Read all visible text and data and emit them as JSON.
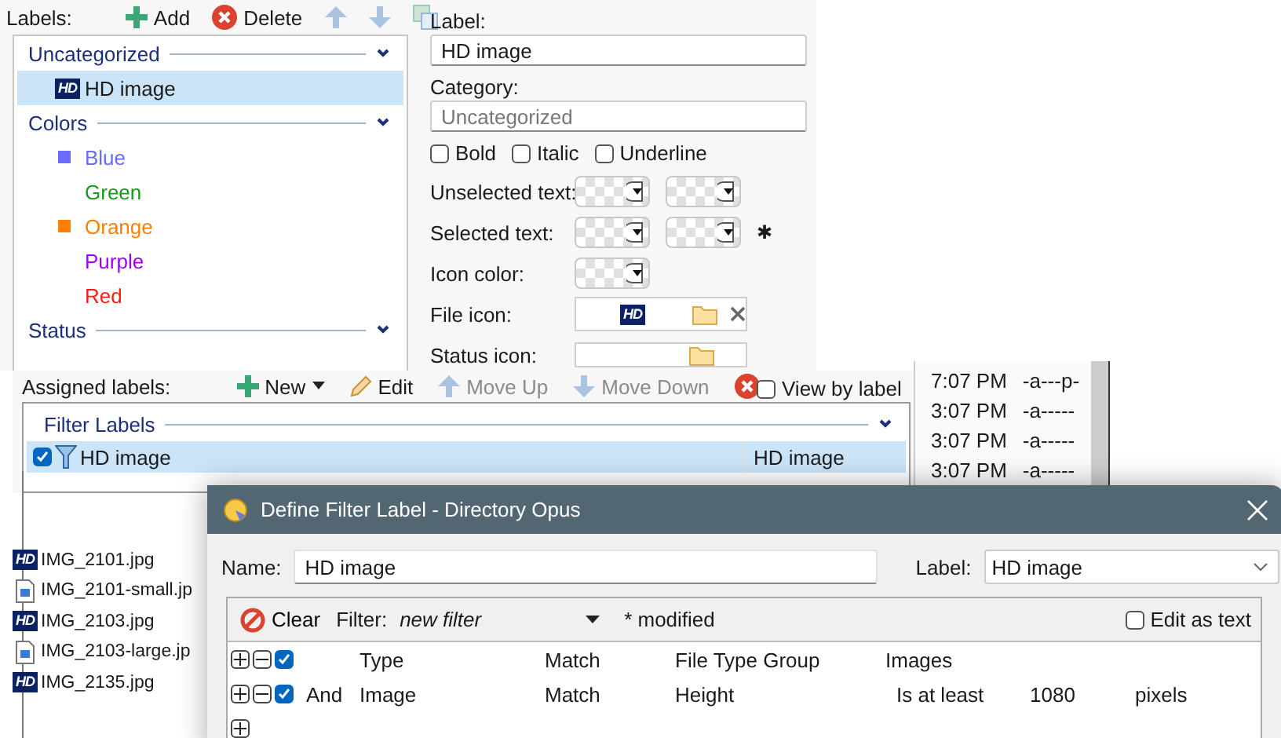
{
  "labels_panel": {
    "caption": "Labels:",
    "toolbar": [
      {
        "kind": "add",
        "label": "Add",
        "disabled": false
      },
      {
        "kind": "delete",
        "label": "Delete",
        "disabled": false
      },
      {
        "kind": "up",
        "disabled": true
      },
      {
        "kind": "down",
        "disabled": true
      },
      {
        "kind": "copy",
        "disabled": true
      }
    ],
    "groups": [
      {
        "name": "Uncategorized",
        "expanded": true,
        "items": [
          {
            "kind": "hd",
            "badge": "HD",
            "label": "HD image",
            "selected": true
          }
        ]
      },
      {
        "name": "Colors",
        "expanded": true,
        "items": [
          {
            "kind": "swatch",
            "label": "Blue",
            "color": "#6b6bff",
            "selected": false
          },
          {
            "kind": "plain",
            "label": "Green",
            "color": "#1a9a1a",
            "selected": false
          },
          {
            "kind": "swatch",
            "label": "Orange",
            "color": "#ff8000",
            "selected": false
          },
          {
            "kind": "plain",
            "label": "Purple",
            "color": "#9b00ff",
            "selected": false
          },
          {
            "kind": "plain",
            "label": "Red",
            "color": "#ff1a1a",
            "selected": false
          }
        ]
      },
      {
        "name": "Status",
        "expanded": true
      }
    ]
  },
  "label_editor": {
    "label_caption": "Label:",
    "label_value": "HD image",
    "category_caption": "Category:",
    "category_placeholder": "Uncategorized",
    "styles": [
      {
        "label": "Bold",
        "checked": false
      },
      {
        "label": "Italic",
        "checked": false
      },
      {
        "label": "Underline",
        "checked": false
      }
    ],
    "rows": [
      {
        "kind": "two_colors",
        "label": "Unselected text:"
      },
      {
        "kind": "two_colors",
        "label": "Selected text:",
        "marker": "✱"
      },
      {
        "kind": "one_color",
        "label": "Icon color:"
      },
      {
        "kind": "icon_file",
        "label": "File icon:",
        "badge": "HD"
      },
      {
        "kind": "icon_empty",
        "label": "Status icon:"
      }
    ]
  },
  "assigned_panel": {
    "caption": "Assigned labels:",
    "toolbar": [
      {
        "kind": "new",
        "label": "New",
        "disabled": false
      },
      {
        "kind": "edit",
        "label": "Edit",
        "disabled": false
      },
      {
        "kind": "up",
        "label": "Move Up",
        "disabled": true
      },
      {
        "kind": "down",
        "label": "Move Down",
        "disabled": true
      },
      {
        "kind": "remove",
        "disabled": false
      }
    ],
    "view_by_label": {
      "label": "View by label",
      "checked": false
    },
    "group": "Filter Labels",
    "rows": [
      {
        "name": "HD image",
        "label": "HD image",
        "checked": true,
        "selected": true
      }
    ]
  },
  "file_times": [
    {
      "time": "7:07 PM",
      "attributes": "-a---p-"
    },
    {
      "time": "3:07 PM",
      "attributes": "-a-----"
    },
    {
      "time": "3:07 PM",
      "attributes": "-a-----"
    },
    {
      "time": "3:07 PM",
      "attributes": "-a-----"
    }
  ],
  "files": [
    {
      "kind": "hd",
      "badge": "HD",
      "name": "IMG_2101.jpg"
    },
    {
      "kind": "image",
      "name": "IMG_2101-small.jp"
    },
    {
      "kind": "hd",
      "badge": "HD",
      "name": "IMG_2103.jpg"
    },
    {
      "kind": "image",
      "name": "IMG_2103-large.jp"
    },
    {
      "kind": "hd",
      "badge": "HD",
      "name": "IMG_2135.jpg"
    }
  ],
  "dialog": {
    "title": "Define Filter Label - Directory Opus",
    "name_caption": "Name:",
    "name_value": "HD image",
    "label_caption": "Label:",
    "label_value": "HD image",
    "clear": "Clear",
    "filter_caption": "Filter:",
    "filter_value": "new filter",
    "modified": "* modified",
    "edit_as_text": {
      "label": "Edit as text",
      "checked": false
    },
    "rules": [
      {
        "checked": true,
        "field": "Type",
        "match": "Match",
        "property": "File Type Group",
        "value": "Images"
      },
      {
        "checked": true,
        "conjunction": "And",
        "field": "Image",
        "match": "Match",
        "property": "Height",
        "condition": "Is at least",
        "value": "1080",
        "unit": "pixels"
      }
    ]
  }
}
